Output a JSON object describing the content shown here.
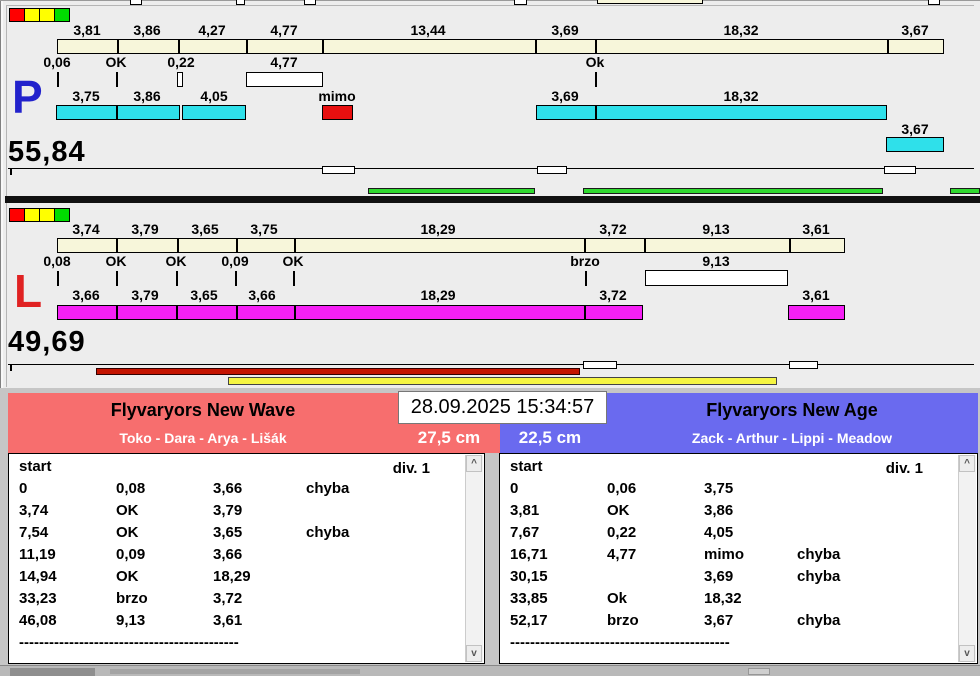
{
  "datetime": "28.09.2025 15:34:57",
  "track_p": {
    "id_label": "P",
    "total": "55,84",
    "lights": [
      "red",
      "yellow",
      "yellow",
      "green"
    ],
    "top_row": [
      "3,81",
      "3,86",
      "4,27",
      "4,77",
      "13,44",
      "3,69",
      "18,32",
      "3,67"
    ],
    "mid_row": [
      "0,06",
      "OK",
      "0,22",
      "4,77",
      "Ok"
    ],
    "bottom_row": [
      "3,75",
      "3,86",
      "4,05",
      "mimo",
      "3,69",
      "18,32",
      "3,67"
    ]
  },
  "track_l": {
    "id_label": "L",
    "total": "49,69",
    "lights": [
      "red",
      "yellow",
      "yellow",
      "green"
    ],
    "top_row": [
      "3,74",
      "3,79",
      "3,65",
      "3,75",
      "18,29",
      "3,72",
      "9,13",
      "3,61"
    ],
    "mid_row": [
      "0,08",
      "OK",
      "OK",
      "0,09",
      "OK",
      "brzo",
      "9,13"
    ],
    "bottom_row": [
      "3,66",
      "3,79",
      "3,65",
      "3,66",
      "18,29",
      "3,72",
      "3,61"
    ]
  },
  "teams": {
    "left": {
      "name": "Flyvaryors New Wave",
      "dogs": "Toko - Dara - Arya - Lišák",
      "jump_height": "27,5 cm",
      "col_start": "start",
      "division": "div. 1",
      "rows": [
        [
          "0",
          "0,08",
          "3,66",
          "chyba"
        ],
        [
          "3,74",
          "OK",
          "3,79",
          ""
        ],
        [
          "7,54",
          "OK",
          "3,65",
          "chyba"
        ],
        [
          "11,19",
          "0,09",
          "3,66",
          ""
        ],
        [
          "14,94",
          "OK",
          "18,29",
          ""
        ],
        [
          "33,23",
          "brzo",
          "3,72",
          ""
        ],
        [
          "46,08",
          "9,13",
          "3,61",
          ""
        ]
      ],
      "divider": "--------------------------------------------"
    },
    "right": {
      "name": "Flyvaryors New Age",
      "dogs": "Zack - Arthur - Lippi - Meadow",
      "jump_height": "22,5 cm",
      "col_start": "start",
      "division": "div. 1",
      "rows": [
        [
          "0",
          "0,06",
          "3,75",
          ""
        ],
        [
          "3,81",
          "OK",
          "3,86",
          ""
        ],
        [
          "7,67",
          "0,22",
          "4,05",
          ""
        ],
        [
          "16,71",
          "4,77",
          "mimo",
          "chyba"
        ],
        [
          "30,15",
          "",
          "3,69",
          "chyba"
        ],
        [
          "33,85",
          "Ok",
          "18,32",
          ""
        ],
        [
          "52,17",
          "brzo",
          "3,67",
          "chyba"
        ]
      ],
      "divider": "--------------------------------------------"
    }
  },
  "scrollbar": {
    "up": "^",
    "down": "v"
  },
  "colors": {
    "segment_fill": "#f7f6da",
    "p_bar": "#2fe0ea",
    "l_bar": "#f520f5",
    "fault_box": "#e80f0f",
    "green_bar": "#30d930",
    "red_bar": "#c41400",
    "yellow_bar": "#f5f542",
    "team_left_header": "#f76e6e",
    "team_right_header": "#6a6aef",
    "p_letter": "#2222cc",
    "l_letter": "#e02222",
    "lights": [
      "#ff0000",
      "#ffff00",
      "#ffff00",
      "#00dd00"
    ]
  }
}
